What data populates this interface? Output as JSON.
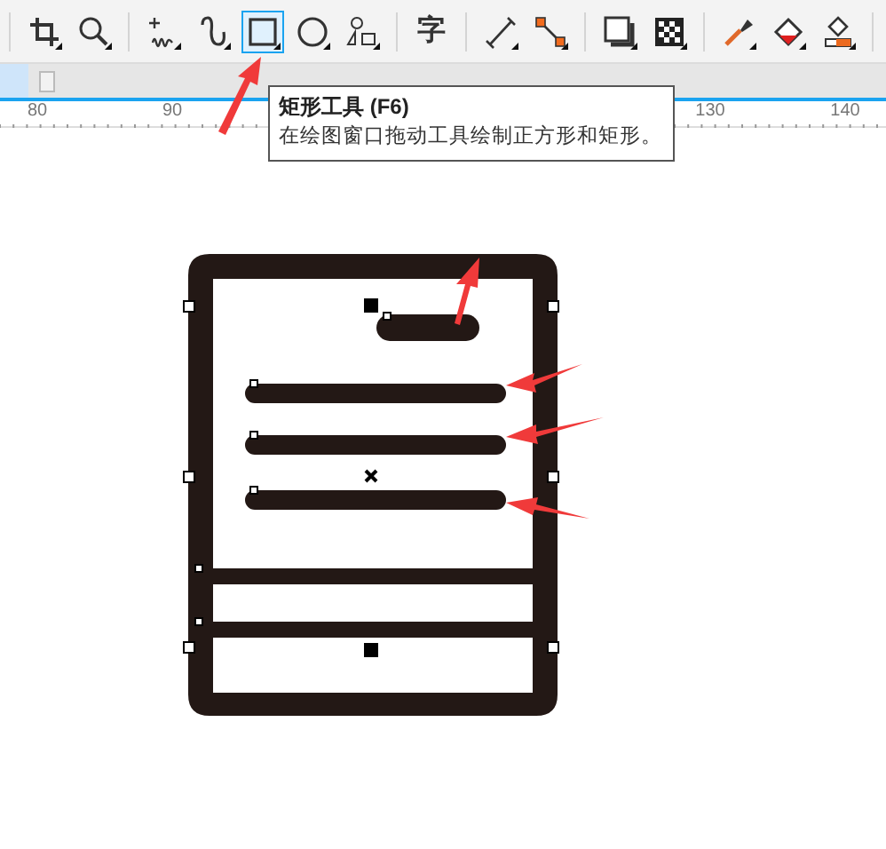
{
  "toolbar": {
    "tools": [
      {
        "kind": "crop",
        "selected": false
      },
      {
        "kind": "zoom",
        "selected": false
      },
      {
        "kind": "freehand",
        "selected": false
      },
      {
        "kind": "bezier",
        "selected": false
      },
      {
        "kind": "rectangle",
        "selected": true
      },
      {
        "kind": "ellipse",
        "selected": false
      },
      {
        "kind": "polygon",
        "selected": false
      },
      {
        "kind": "text",
        "label": "字",
        "selected": false
      },
      {
        "kind": "dimension",
        "selected": false
      },
      {
        "kind": "connector",
        "selected": false
      },
      {
        "kind": "shadow",
        "selected": false
      },
      {
        "kind": "transparency",
        "selected": false
      },
      {
        "kind": "eyedropper",
        "selected": false
      },
      {
        "kind": "fill",
        "selected": false
      },
      {
        "kind": "interactive-fill",
        "selected": false
      }
    ]
  },
  "tooltip": {
    "title": "矩形工具 (F6)",
    "description": "在绘图窗口拖动工具绘制正方形和矩形。"
  },
  "ruler": {
    "labels": [
      "80",
      "90",
      "130",
      "140"
    ]
  }
}
